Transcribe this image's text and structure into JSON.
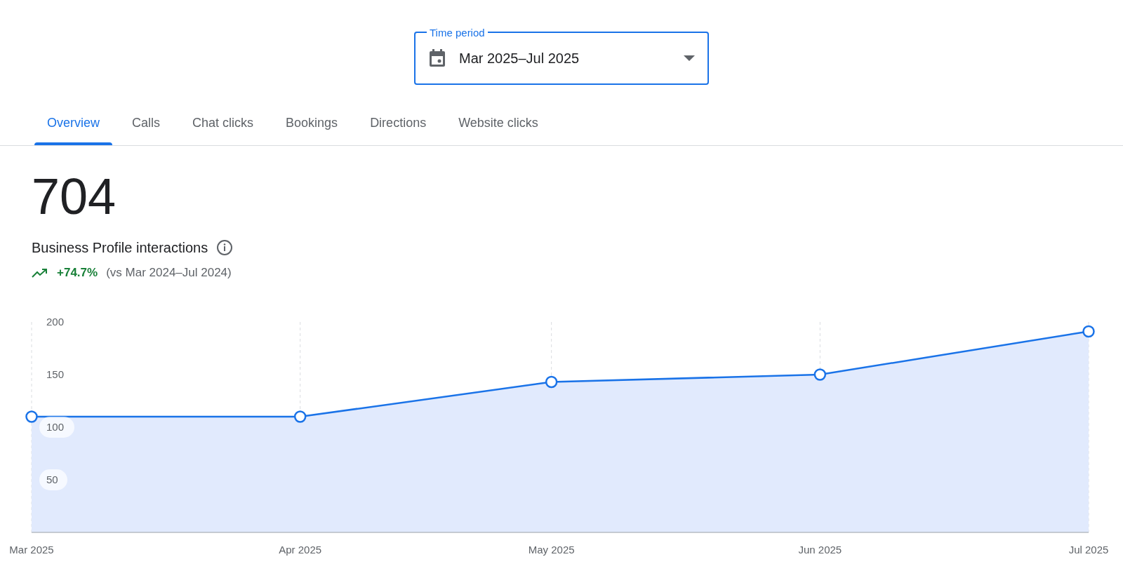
{
  "time_period": {
    "label": "Time period",
    "value": "Mar 2025–Jul 2025"
  },
  "tabs": [
    {
      "label": "Overview",
      "selected": true
    },
    {
      "label": "Calls",
      "selected": false
    },
    {
      "label": "Chat clicks",
      "selected": false
    },
    {
      "label": "Bookings",
      "selected": false
    },
    {
      "label": "Directions",
      "selected": false
    },
    {
      "label": "Website clicks",
      "selected": false
    }
  ],
  "summary": {
    "total": "704",
    "label": "Business Profile interactions",
    "change": "+74.7%",
    "comparison": "(vs Mar 2024–Jul 2024)"
  },
  "chart_data": {
    "type": "area",
    "categories": [
      "Mar 2025",
      "Apr 2025",
      "May 2025",
      "Jun 2025",
      "Jul 2025"
    ],
    "series": [
      {
        "color": "#1a73e8",
        "values": [
          110,
          110,
          143,
          150,
          191
        ]
      }
    ],
    "ylim": [
      0,
      200
    ],
    "yticks": [
      50,
      100,
      150,
      200
    ]
  }
}
